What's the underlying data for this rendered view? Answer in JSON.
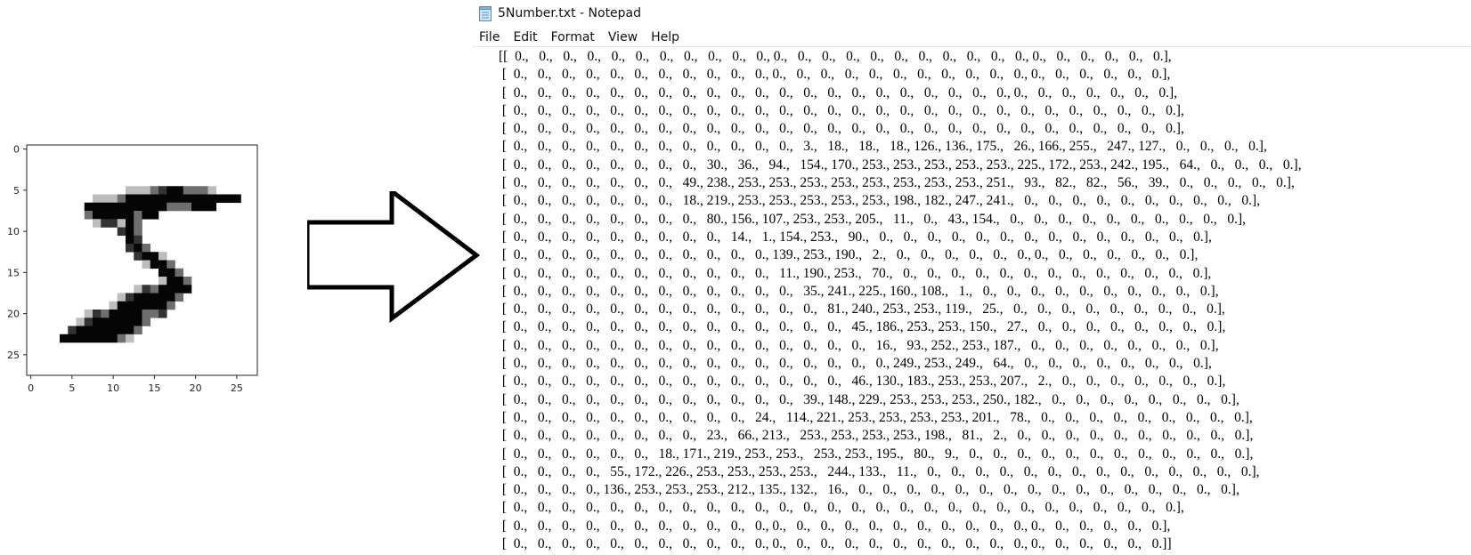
{
  "plot": {
    "x_ticks": [
      "0",
      "5",
      "10",
      "15",
      "20",
      "25"
    ],
    "y_ticks": [
      "0",
      "5",
      "10",
      "15",
      "20",
      "25"
    ],
    "image": [
      "............................",
      "............................",
      "............................",
      "............................",
      "............................",
      "............AAAB+##BBBA.....",
      "........AAAB##############..",
      ".......##########BBB###.....",
      ".......B#####B##............",
      "........A++A#B..............",
      "...........+#B..............",
      "............#+..............",
      "............+#B.............",
      ".............+##A...........",
      "..............A##B..........",
      "................##B.........",
      "................A##B........",
      ".............A+B####........",
      "...........A+#####B.........",
      "..........A######B..........",
      ".......A+B####BB+...........",
      "......A+######B.............",
      ".....+#######B..............",
      "....#######BA...............",
      "............................",
      "............................",
      "............................",
      "............................"
    ]
  },
  "notepad": {
    "title": "5Number.txt - Notepad",
    "menu": [
      "File",
      "Edit",
      "Format",
      "View",
      "Help"
    ],
    "lines": [
      "[[  0.,   0.,   0.,   0.,   0.,   0.,   0.,   0.,   0.,   0.,   0., 0.,   0.,   0.,   0.,   0.,   0.,   0.,   0.,   0.,   0.,   0., 0.,   0.,   0.,   0.,   0.,   0.],",
      " [  0.,   0.,   0.,   0.,   0.,   0.,   0.,   0.,   0.,   0.,   0., 0.,   0.,   0.,   0.,   0.,   0.,   0.,   0.,   0.,   0.,   0., 0.,   0.,   0.,   0.,   0.,   0.],",
      " [  0.,   0.,   0.,   0.,   0.,   0.,   0.,   0.,   0.,   0.,   0.,   0.,   0.,   0.,   0.,   0.,   0.,   0.,   0.,   0.,   0., 0.,   0.,   0.,   0.,   0.,   0.,   0.],",
      " [  0.,   0.,   0.,   0.,   0.,   0.,   0.,   0.,   0.,   0.,   0.,   0.,   0.,   0.,   0.,   0.,   0.,   0.,   0.,   0.,   0.,   0.,   0.,   0.,   0.,   0.,   0.,   0.],",
      " [  0.,   0.,   0.,   0.,   0.,   0.,   0.,   0.,   0.,   0.,   0.,   0.,   0.,   0.,   0.,   0.,   0.,   0.,   0.,   0.,   0.,   0.,   0.,   0.,   0.,   0.,   0.,   0.],",
      " [  0.,   0.,   0.,   0.,   0.,   0.,   0.,   0.,   0.,   0.,   0.,   0.,   3.,   18.,   18.,   18., 126., 136., 175.,   26., 166., 255.,   247., 127.,   0.,   0.,   0.,   0.],",
      " [  0.,   0.,   0.,   0.,   0.,   0.,   0.,   0.,   30.,   36.,   94.,   154., 170., 253., 253., 253., 253., 253., 225., 172., 253., 242., 195.,   64.,   0.,   0.,   0.,   0.],",
      " [  0.,   0.,   0.,   0.,   0.,   0.,   0.,   49., 238., 253., 253., 253., 253., 253., 253., 253., 253., 251.,   93.,   82.,   82.,   56.,   39.,   0.,   0.,   0.,   0.,   0.],",
      " [  0.,   0.,   0.,   0.,   0.,   0.,   0.,   18., 219., 253., 253., 253., 253., 253., 198., 182., 247., 241.,   0.,   0.,   0.,   0.,   0.,   0.,   0.,   0.,   0.,   0.],",
      " [  0.,   0.,   0.,   0.,   0.,   0.,   0.,   0.,   80., 156., 107., 253., 253., 205.,   11.,   0.,   43., 154.,   0.,   0.,   0.,   0.,   0.,   0.,   0.,   0.,   0.,   0.],",
      " [  0.,   0.,   0.,   0.,   0.,   0.,   0.,   0.,   0.,   14.,   1., 154., 253.,   90.,   0.,   0.,   0.,   0.,   0.,   0.,   0.,   0.,   0.,   0.,   0.,   0.,   0.,   0.],",
      " [  0.,   0.,   0.,   0.,   0.,   0.,   0.,   0.,   0.,   0.,   0., 139., 253., 190.,   2.,   0.,   0.,   0.,   0.,   0.,   0., 0.,   0.,   0.,   0.,   0.,   0.,   0.],",
      " [  0.,   0.,   0.,   0.,   0.,   0.,   0.,   0.,   0.,   0.,   0.,   11., 190., 253.,   70.,   0.,   0.,   0.,   0.,   0.,   0.,   0.,   0.,   0.,   0.,   0.,   0.,   0.],",
      " [  0.,   0.,   0.,   0.,   0.,   0.,   0.,   0.,   0.,   0.,   0.,   0.,   35., 241., 225., 160., 108.,   1.,   0.,   0.,   0.,   0.,   0.,   0.,   0.,   0.,   0.,   0.],",
      " [  0.,   0.,   0.,   0.,   0.,   0.,   0.,   0.,   0.,   0.,   0.,   0.,   0.,   81., 240., 253., 253., 119.,   25.,   0.,   0.,   0.,   0.,   0.,   0.,   0.,   0.,   0.],",
      " [  0.,   0.,   0.,   0.,   0.,   0.,   0.,   0.,   0.,   0.,   0.,   0.,   0.,   0.,   45., 186., 253., 253., 150.,   27.,   0.,   0.,   0.,   0.,   0.,   0.,   0.,   0.],",
      " [  0.,   0.,   0.,   0.,   0.,   0.,   0.,   0.,   0.,   0.,   0.,   0.,   0.,   0.,   0.,   16.,   93., 252., 253., 187.,   0.,   0.,   0.,   0.,   0.,   0.,   0.,   0.],",
      " [  0.,   0.,   0.,   0.,   0.,   0.,   0.,   0.,   0.,   0.,   0.,   0.,   0.,   0.,   0.,   0., 249., 253., 249.,   64.,   0.,   0.,   0.,   0.,   0.,   0.,   0.,   0.],",
      " [  0.,   0.,   0.,   0.,   0.,   0.,   0.,   0.,   0.,   0.,   0.,   0.,   0.,   0.,   46., 130., 183., 253., 253., 207.,   2.,   0.,   0.,   0.,   0.,   0.,   0.,   0.],",
      " [  0.,   0.,   0.,   0.,   0.,   0.,   0.,   0.,   0.,   0.,   0.,   0.,   39., 148., 229., 253., 253., 253., 250., 182.,   0.,   0.,   0.,   0.,   0.,   0.,   0.,   0.],",
      " [  0.,   0.,   0.,   0.,   0.,   0.,   0.,   0.,   0.,   0.,   24.,   114., 221., 253., 253., 253., 253., 201.,   78.,   0.,   0.,   0.,   0.,   0.,   0.,   0.,   0.,   0.],",
      " [  0.,   0.,   0.,   0.,   0.,   0.,   0.,   0.,   23.,   66., 213.,   253., 253., 253., 253., 198.,   81.,   2.,   0.,   0.,   0.,   0.,   0.,   0.,   0.,   0.,   0.,   0.],",
      " [  0.,   0.,   0.,   0.,   0.,   0.,   18., 171., 219., 253., 253.,   253., 253., 195.,   80.,   9.,   0.,   0.,   0.,   0.,   0.,   0.,   0.,   0.,   0.,   0.,   0.,   0.],",
      " [  0.,   0.,   0.,   0.,   55., 172., 226., 253., 253., 253., 253.,   244., 133.,   11.,   0.,   0.,   0.,   0.,   0.,   0.,   0.,   0.,   0.,   0.,   0.,   0.,   0.,   0.],",
      " [  0.,   0.,   0.,   0., 136., 253., 253., 253., 212., 135., 132.,   16.,   0.,   0.,   0.,   0.,   0.,   0.,   0.,   0.,   0.,   0.,   0.,   0.,   0.,   0.,   0.,   0.],",
      " [  0.,   0.,   0.,   0.,   0.,   0.,   0.,   0.,   0.,   0.,   0.,   0.,   0.,   0.,   0.,   0.,   0.,   0.,   0.,   0.,   0.,   0.,   0.,   0.,   0.,   0.,   0.,   0.],",
      " [  0.,   0.,   0.,   0.,   0.,   0.,   0.,   0.,   0.,   0.,   0., 0.,   0.,   0.,   0.,   0.,   0.,   0.,   0.,   0.,   0.,   0., 0.,   0.,   0.,   0.,   0.,   0.],",
      " [  0.,   0.,   0.,   0.,   0.,   0.,   0.,   0.,   0.,   0.,   0., 0.,   0.,   0.,   0.,   0.,   0.,   0.,   0.,   0.,   0.,   0., 0.,   0.,   0.,   0.,   0.,   0.]]"
    ]
  }
}
